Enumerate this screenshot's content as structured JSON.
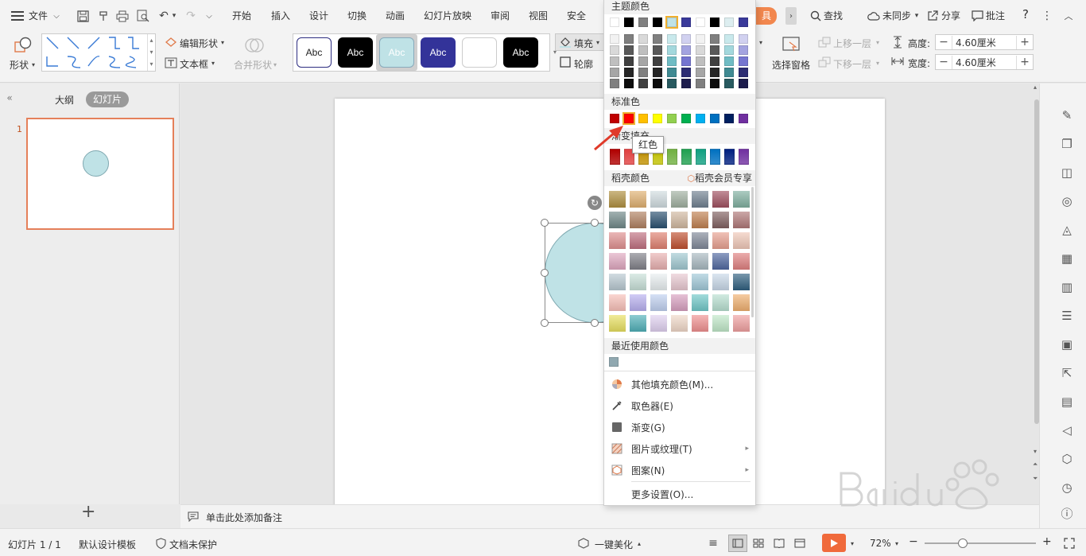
{
  "menubar": {
    "file": "文件",
    "tabs": [
      "开始",
      "插入",
      "设计",
      "切换",
      "动画",
      "幻灯片放映",
      "审阅",
      "视图",
      "安全"
    ],
    "partial_tab": "具",
    "search": "查找",
    "sync": "未同步",
    "share": "分享",
    "comment": "批注",
    "help": "?"
  },
  "ribbon": {
    "shape": "形状",
    "edit_shape": "编辑形状",
    "text_box": "文本框",
    "merge_shape": "合并形状",
    "style_samples": [
      "Abc",
      "Abc",
      "Abc",
      "Abc",
      "",
      "Abc"
    ],
    "fill": "填充",
    "outline": "轮廓",
    "select_pane": "选择窗格",
    "bring_up": "上移一层",
    "send_down": "下移一层",
    "height_label": "高度:",
    "height_value": "4.60厘米",
    "width_label": "宽度:",
    "width_value": "4.60厘米"
  },
  "leftpanel": {
    "outline_tab": "大纲",
    "slides_tab": "幻灯片",
    "slide_number": "1",
    "add": "+"
  },
  "notes": {
    "placeholder": "单击此处添加备注"
  },
  "statusbar": {
    "slide_info": "幻灯片 1 / 1",
    "template": "默认设计模板",
    "protect": "文档未保护",
    "beautify": "一键美化",
    "zoom": "72%",
    "minus": "−",
    "plus": "+"
  },
  "colormenu": {
    "theme_title": "主题颜色",
    "standard_title": "标准色",
    "gradient_title": "渐变填充",
    "docer_title": "稻壳颜色",
    "docer_vip": "稻壳会员专享",
    "recent_title": "最近使用颜色",
    "tooltip": "红色",
    "items": [
      {
        "label": "其他填充颜色(M)...",
        "icon": "palette-icon",
        "arrow": false
      },
      {
        "label": "取色器(E)",
        "icon": "eyedropper-icon",
        "arrow": false
      },
      {
        "label": "渐变(G)",
        "icon": "gradient-icon",
        "arrow": false
      },
      {
        "label": "图片或纹理(T)",
        "icon": "texture-icon",
        "arrow": true
      },
      {
        "label": "图案(N)",
        "icon": "pattern-icon",
        "arrow": true
      },
      {
        "label": "更多设置(O)...",
        "icon": "",
        "arrow": false
      }
    ],
    "theme_row": [
      "#ffffff",
      "#000000",
      "#808080",
      "#000000",
      "#bfe2e6",
      "#3a3a9a",
      "#ffffff",
      "#000000",
      "#ddeef0",
      "#3a3a9a"
    ],
    "theme_shade_cols": [
      [
        "#f2f2f2",
        "#d9d9d9",
        "#bfbfbf",
        "#a6a6a6",
        "#808080"
      ],
      [
        "#7f7f7f",
        "#595959",
        "#404040",
        "#262626",
        "#0d0d0d"
      ],
      [
        "#d9d9d9",
        "#bfbfbf",
        "#a6a6a6",
        "#808080",
        "#404040"
      ],
      [
        "#808080",
        "#595959",
        "#404040",
        "#262626",
        "#0d0d0d"
      ],
      [
        "#c9e9ec",
        "#a3d8dd",
        "#6fbcc4",
        "#3f8a92",
        "#285a60"
      ],
      [
        "#d1d1f0",
        "#a3a3e0",
        "#7575d0",
        "#2c2c73",
        "#1d1d4d"
      ],
      [
        "#f2f2f2",
        "#d9d9d9",
        "#bfbfbf",
        "#a6a6a6",
        "#808080"
      ],
      [
        "#7f7f7f",
        "#595959",
        "#404040",
        "#262626",
        "#0d0d0d"
      ],
      [
        "#c9e9ec",
        "#a3d8dd",
        "#6fbcc4",
        "#3f8a92",
        "#285a60"
      ],
      [
        "#d1d1f0",
        "#a3a3e0",
        "#7575d0",
        "#2c2c73",
        "#1d1d4d"
      ]
    ],
    "standard_colors": [
      "#c00000",
      "#ff0000",
      "#ffc000",
      "#ffff00",
      "#92d050",
      "#00b050",
      "#00b0f0",
      "#0070c0",
      "#002060",
      "#7030a0"
    ],
    "gradient_colors": [
      "#b00000",
      "#e04040",
      "#c09000",
      "#c0c000",
      "#70b040",
      "#20a050",
      "#10a080",
      "#0070c0",
      "#002080",
      "#7030a0"
    ],
    "docer_colors": [
      [
        "#b09040",
        "#e0b070",
        "#d0dce0",
        "#a0b0a0",
        "#708090",
        "#a05060",
        "#80b0a0"
      ],
      [
        "#708888",
        "#b08060",
        "#2a5070",
        "#d0b8a0",
        "#c08050",
        "#806060",
        "#b07878"
      ],
      [
        "#e09090",
        "#c07080",
        "#e08070",
        "#c05030",
        "#808898",
        "#e8a090",
        "#f0c8b8"
      ],
      [
        "#e0a8c0",
        "#808088",
        "#e8b0b0",
        "#a0c8d0",
        "#a8b8c0",
        "#5068a0",
        "#e08080"
      ],
      [
        "#b8c8d0",
        "#c8e0d8",
        "#e8eef0",
        "#e8c8d0",
        "#a0c8d8",
        "#c8d8e8",
        "#306080"
      ],
      [
        "#f8c0b8",
        "#b8b0f0",
        "#c0d0f0",
        "#d8a0c0",
        "#70c8c8",
        "#b8e0d0",
        "#f0b070"
      ],
      [
        "#e8e060",
        "#50b0b8",
        "#e0d0f0",
        "#f0d8c8",
        "#f09090",
        "#c0e8c8",
        "#f0a0a0"
      ]
    ],
    "recent_colors": [
      "#90a8b0"
    ]
  }
}
